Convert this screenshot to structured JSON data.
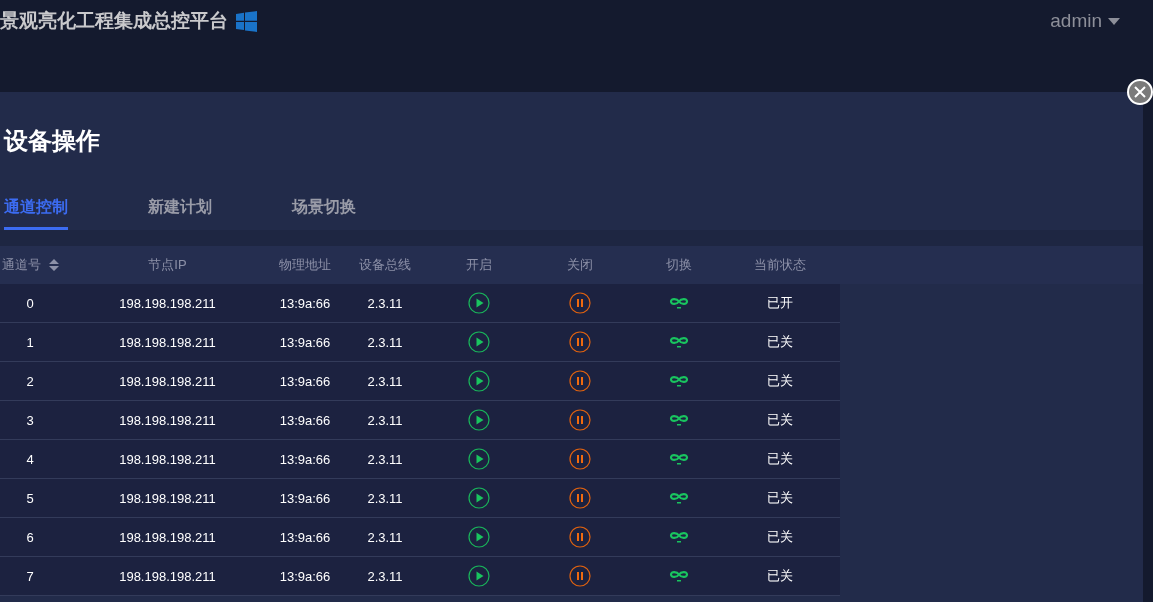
{
  "header": {
    "title": "景观亮化工程集成总控平台",
    "user": "admin"
  },
  "dialog": {
    "title": "设备操作",
    "tabs": [
      {
        "label": "通道控制",
        "selected": true
      },
      {
        "label": "新建计划",
        "selected": false
      },
      {
        "label": "场景切换",
        "selected": false
      }
    ],
    "table": {
      "columns": [
        "通道号",
        "节点IP",
        "物理地址",
        "设备总线",
        "开启",
        "关闭",
        "切换",
        "当前状态"
      ],
      "rows": [
        {
          "channel": "0",
          "ip": "198.198.198.211",
          "mac": "13:9a:66",
          "bus": "2.3.11",
          "status": "已开"
        },
        {
          "channel": "1",
          "ip": "198.198.198.211",
          "mac": "13:9a:66",
          "bus": "2.3.11",
          "status": "已关"
        },
        {
          "channel": "2",
          "ip": "198.198.198.211",
          "mac": "13:9a:66",
          "bus": "2.3.11",
          "status": "已关"
        },
        {
          "channel": "3",
          "ip": "198.198.198.211",
          "mac": "13:9a:66",
          "bus": "2.3.11",
          "status": "已关"
        },
        {
          "channel": "4",
          "ip": "198.198.198.211",
          "mac": "13:9a:66",
          "bus": "2.3.11",
          "status": "已关"
        },
        {
          "channel": "5",
          "ip": "198.198.198.211",
          "mac": "13:9a:66",
          "bus": "2.3.11",
          "status": "已关"
        },
        {
          "channel": "6",
          "ip": "198.198.198.211",
          "mac": "13:9a:66",
          "bus": "2.3.11",
          "status": "已关"
        },
        {
          "channel": "7",
          "ip": "198.198.198.211",
          "mac": "13:9a:66",
          "bus": "2.3.11",
          "status": "已关"
        }
      ]
    }
  }
}
